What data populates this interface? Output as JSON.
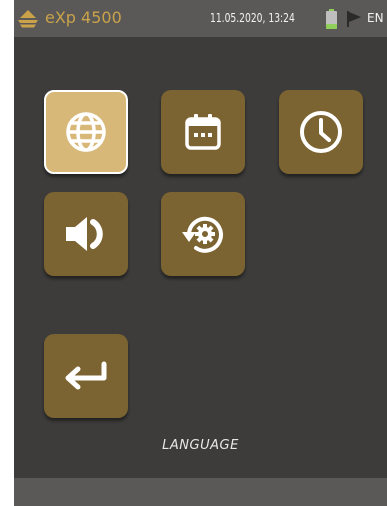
{
  "status_bar": {
    "app_title": "eXp 4500",
    "datetime": "11.05.2020, 13:24",
    "language_code": "EN",
    "battery_level": 0.3,
    "battery_color": "#8fcf5a"
  },
  "menu": {
    "tiles": [
      {
        "id": "language",
        "icon": "globe-icon",
        "selected": true
      },
      {
        "id": "date",
        "icon": "calendar-icon",
        "selected": false
      },
      {
        "id": "time",
        "icon": "clock-icon",
        "selected": false
      },
      {
        "id": "volume",
        "icon": "speaker-icon",
        "selected": false
      },
      {
        "id": "reset",
        "icon": "settings-restore-icon",
        "selected": false
      },
      {
        "id": "back",
        "icon": "return-arrow-icon",
        "selected": false
      }
    ],
    "caption": "LANGUAGE"
  },
  "colors": {
    "accent": "#c9a24a",
    "tile": "#7b6431",
    "tile_selected": "#d8b878",
    "background": "#3d3c3b",
    "bar": "#5a5957"
  }
}
